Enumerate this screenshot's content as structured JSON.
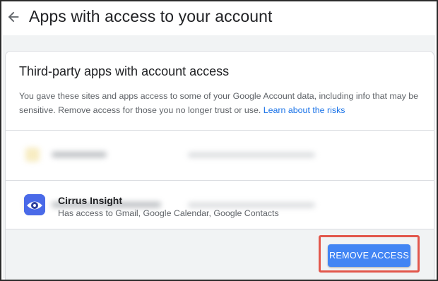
{
  "header": {
    "title": "Apps with access to your account",
    "back_icon": "arrow-left-icon"
  },
  "card": {
    "title": "Third-party apps with account access",
    "description": "You gave these sites and apps access to some of your Google Account data, including info that may be sensitive. Remove access for those you no longer trust or use.",
    "link_label": "Learn about the risks",
    "link_color": "#1a73e8"
  },
  "selected_app": {
    "name": "Cirrus Insight",
    "access": "Has access to Gmail, Google Calendar, Google Contacts",
    "icon": "eye-app-icon",
    "remove_label": "REMOVE ACCESS"
  },
  "colors": {
    "primary_button": "#4285f4",
    "highlight_border": "#e2574c"
  }
}
